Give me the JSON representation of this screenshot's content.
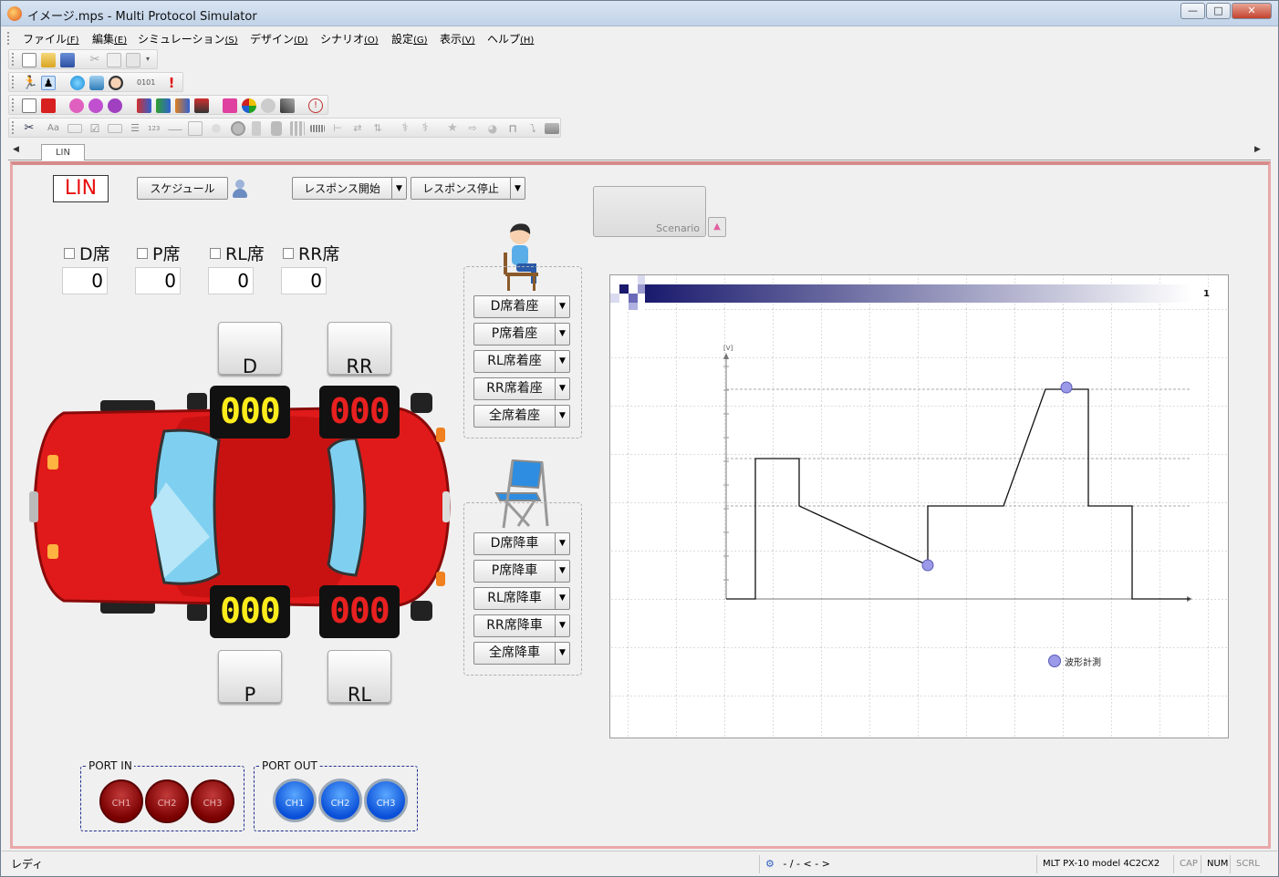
{
  "window": {
    "title": "イメージ.mps - Multi Protocol Simulator"
  },
  "menu": [
    {
      "label": "ファイル",
      "key": "(F)"
    },
    {
      "label": "編集",
      "key": "(E)"
    },
    {
      "label": "シミュレーション",
      "key": "(S)"
    },
    {
      "label": "デザイン",
      "key": "(D)"
    },
    {
      "label": "シナリオ",
      "key": "(O)"
    },
    {
      "label": "設定",
      "key": "(G)"
    },
    {
      "label": "表示",
      "key": "(V)"
    },
    {
      "label": "ヘルプ",
      "key": "(H)"
    }
  ],
  "tabs": {
    "active": "LIN"
  },
  "panel": {
    "title_badge": "LIN",
    "schedule_button": "スケジュール",
    "response_start": "レスポンス開始",
    "response_stop": "レスポンス停止",
    "scenario_button": "Scenario",
    "seats": [
      {
        "label": "D席",
        "value": "0"
      },
      {
        "label": "P席",
        "value": "0"
      },
      {
        "label": "RL席",
        "value": "0"
      },
      {
        "label": "RR席",
        "value": "0"
      }
    ],
    "door_keys": {
      "d": "D",
      "rr": "RR",
      "p": "P",
      "rl": "RL"
    },
    "displays": {
      "fl": "000",
      "fr": "000",
      "rl": "000",
      "rr": "000"
    },
    "sit_buttons": [
      "D席着座",
      "P席着座",
      "RL席着座",
      "RR席着座",
      "全席着座"
    ],
    "leave_buttons": [
      "D席降車",
      "P席降車",
      "RL席降車",
      "RR席降車",
      "全席降車"
    ],
    "port_in": {
      "title": "PORT IN",
      "channels": [
        "CH1",
        "CH2",
        "CH3"
      ]
    },
    "port_out": {
      "title": "PORT OUT",
      "channels": [
        "CH1",
        "CH2",
        "CH3"
      ]
    }
  },
  "waveform": {
    "page_number": "1",
    "y_axis_label": "[V]",
    "legend_label": "波形計測",
    "colors": {
      "line": "#111111",
      "marker": "#9a9ae8",
      "header": "#1a1a6e"
    }
  },
  "status": {
    "ready": "レディ",
    "nav": "- / - < - >",
    "device": "MLT PX-10 model 4C2CX2",
    "cap": "CAP",
    "num": "NUM",
    "scrl": "SCRL"
  }
}
